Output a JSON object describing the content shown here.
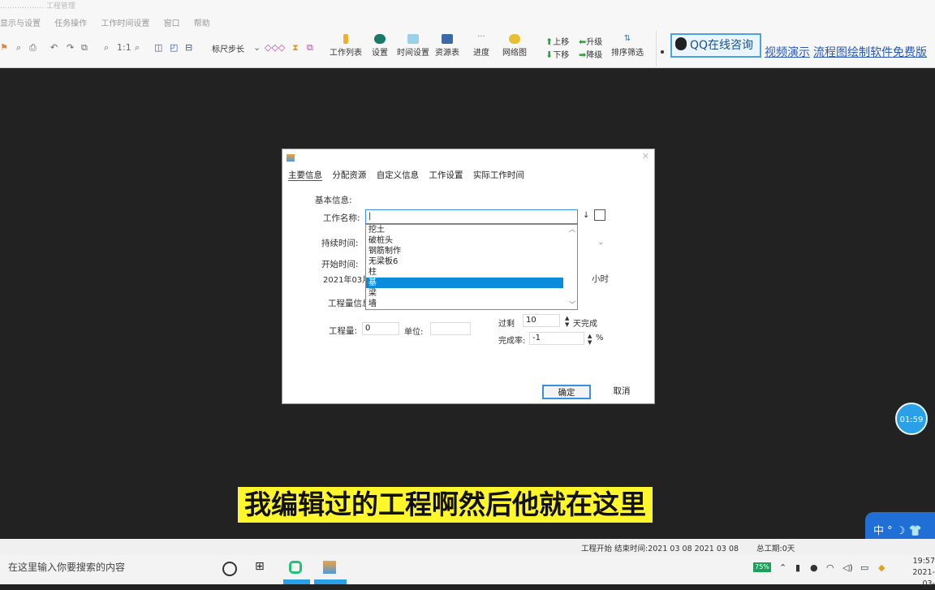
{
  "window_title": "……………… 工程管理",
  "menu": [
    "显示与设置",
    "任务操作",
    "工作时间设置",
    "窗口",
    "帮助"
  ],
  "toolbar": {
    "zoom_ratio": "1:1",
    "ruler_step": "标尺步长",
    "buttons": [
      "工作列表",
      "设置",
      "时间设置",
      "资源表",
      "进度",
      "网络图"
    ],
    "move_up": "上移",
    "move_down": "下移",
    "promote": "升级",
    "demote": "降级",
    "sort_filter": "排序筛选"
  },
  "right_bar": {
    "qq_label": "QQ在线咨询",
    "video_link": "视频演示",
    "flowchart_link": "流程图绘制软件免费版"
  },
  "dialog": {
    "tabs": [
      "主要信息",
      "分配资源",
      "自定义信息",
      "工作设置",
      "实际工作时间"
    ],
    "section_basic": "基本信息:",
    "name_label": "工作名称:",
    "name_value": "|",
    "duration_label": "持续时间:",
    "start_label": "开始时间:",
    "start_value": "2021年03月",
    "hours_unit": "小时",
    "workload_info_label": "工程量信息",
    "workload_label": "工程量:",
    "workload_value": "0",
    "unit_label": "单位:",
    "overdue_label": "过剩",
    "overdue_value": "10",
    "days_done": "天完成",
    "completion_label": "完成率:",
    "completion_value": "-1",
    "percent": "%",
    "ok": "确定",
    "cancel": "取消",
    "dropdown_items": [
      "挖土",
      "破桩头",
      "钢筋制作",
      "无梁板6",
      "柱",
      "基",
      "梁",
      "墙"
    ],
    "selected_index": 5
  },
  "subtitle": "我编辑过的工程啊然后他就在这里",
  "timer": "01:59",
  "ime_label": "中 ° ☽ 👕",
  "status": {
    "project_time": "工程开始 结束时间:2021 03 08 2021 03 08",
    "total_work": "总工期:0天"
  },
  "taskbar": {
    "search_placeholder": "在这里输入你要搜索的内容",
    "battery": "75%",
    "time": "19:57",
    "date": "2021-03-"
  }
}
